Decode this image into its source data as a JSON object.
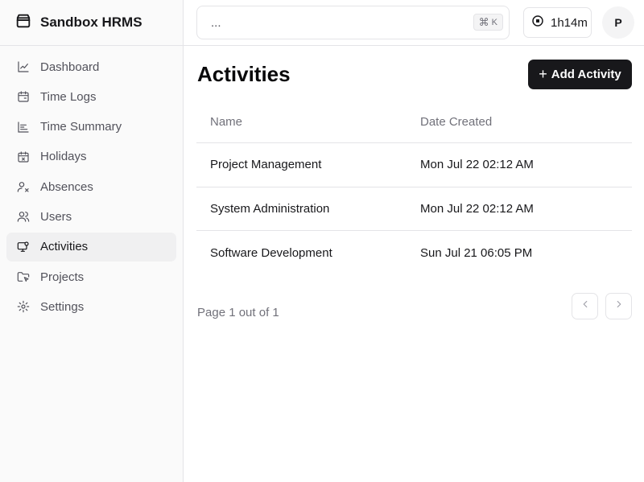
{
  "brand": {
    "name": "Sandbox HRMS"
  },
  "sidebar": {
    "items": [
      {
        "label": "Dashboard",
        "icon": "chart-line-icon",
        "active": false
      },
      {
        "label": "Time Logs",
        "icon": "calendar-clock-icon",
        "active": false
      },
      {
        "label": "Time Summary",
        "icon": "bar-list-icon",
        "active": false
      },
      {
        "label": "Holidays",
        "icon": "calendar-x-icon",
        "active": false
      },
      {
        "label": "Absences",
        "icon": "user-x-icon",
        "active": false
      },
      {
        "label": "Users",
        "icon": "users-icon",
        "active": false
      },
      {
        "label": "Activities",
        "icon": "monitor-activity-icon",
        "active": true
      },
      {
        "label": "Projects",
        "icon": "folder-pointer-icon",
        "active": false
      },
      {
        "label": "Settings",
        "icon": "gear-icon",
        "active": false
      }
    ]
  },
  "topbar": {
    "search_placeholder": "...",
    "shortcut_symbol": "⌘",
    "shortcut_key": "K",
    "timer": "1h14m",
    "avatar_initial": "P"
  },
  "page": {
    "title": "Activities",
    "add_button": "Add Activity",
    "add_button_icon": "+"
  },
  "table": {
    "headers": [
      "Name",
      "Date Created"
    ],
    "rows": [
      [
        "Project Management",
        "Mon Jul 22 02:12 AM"
      ],
      [
        "System Administration",
        "Mon Jul 22 02:12 AM"
      ],
      [
        "Software Development",
        "Sun Jul 21 06:05 PM"
      ]
    ]
  },
  "pagination": {
    "text": "Page 1 out of 1"
  },
  "colors": {
    "primary": "#18181b",
    "muted": "#71717a",
    "border": "#e4e4e7",
    "sidebar_bg": "#fafafa",
    "active_bg": "#f0f0f1"
  }
}
